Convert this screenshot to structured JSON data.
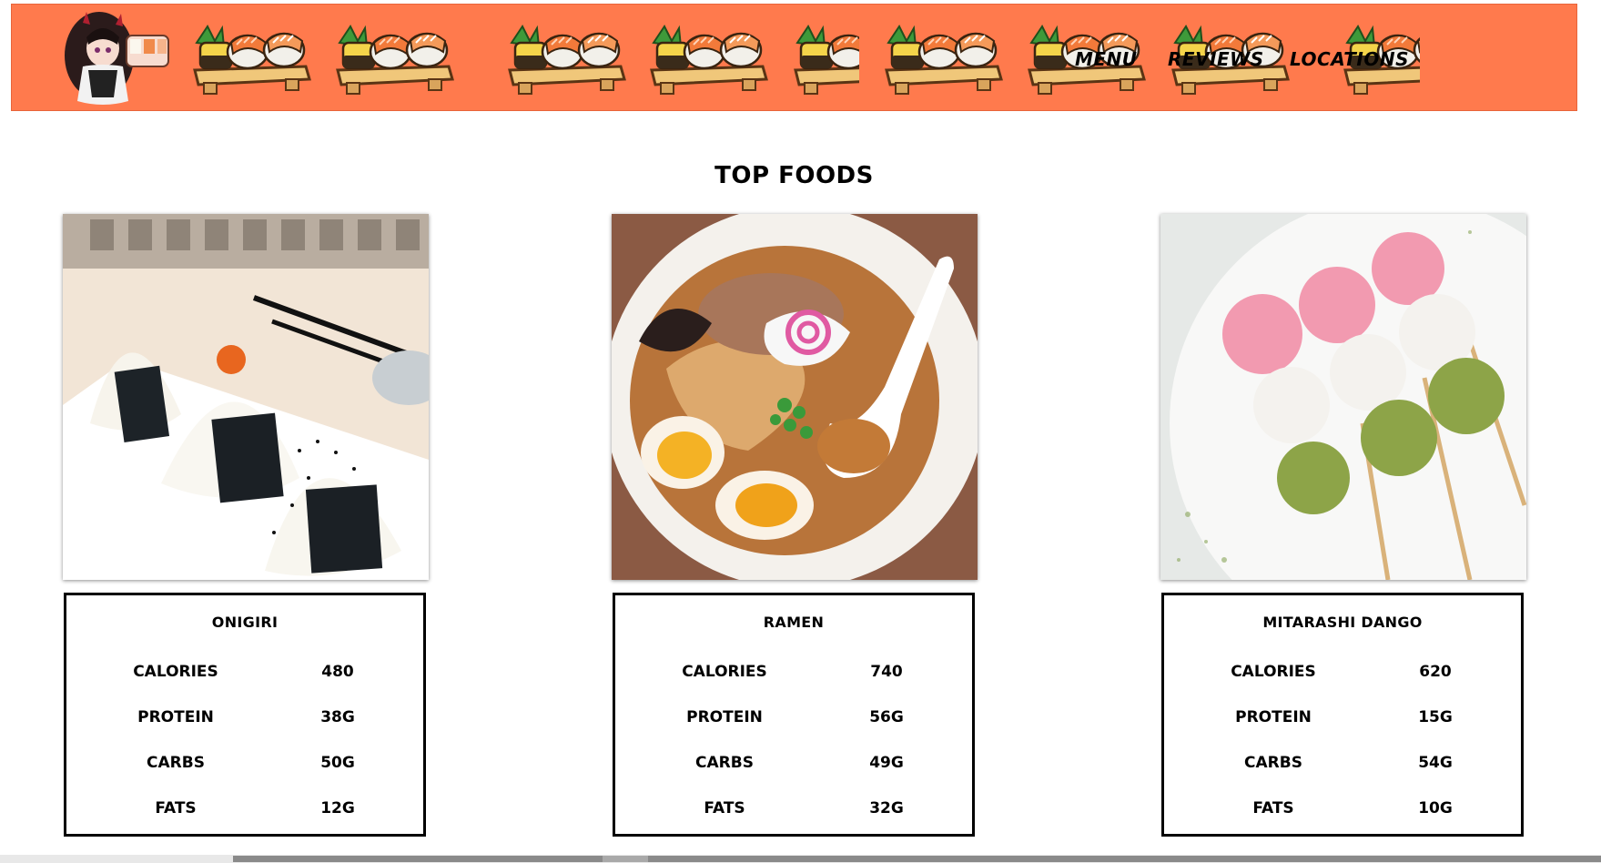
{
  "header": {
    "background_color": "#ff7a4d",
    "nav": [
      {
        "label": "Menu"
      },
      {
        "label": "Reviews"
      },
      {
        "label": "Locations"
      }
    ]
  },
  "main": {
    "section_title": "TOP FOODS",
    "foods": [
      {
        "name": "ONIGIRI",
        "image": "onigiri-photo",
        "stats": [
          {
            "label": "CALORIES",
            "value": "480"
          },
          {
            "label": "PROTEIN",
            "value": "38G"
          },
          {
            "label": "CARBS",
            "value": "50G"
          },
          {
            "label": "FATS",
            "value": "12G"
          }
        ]
      },
      {
        "name": "RAMEN",
        "image": "ramen-photo",
        "stats": [
          {
            "label": "CALORIES",
            "value": "740"
          },
          {
            "label": "PROTEIN",
            "value": "56G"
          },
          {
            "label": "CARBS",
            "value": "49G"
          },
          {
            "label": "FATS",
            "value": "32G"
          }
        ]
      },
      {
        "name": "MITARASHI DANGO",
        "image": "dango-photo",
        "stats": [
          {
            "label": "CALORIES",
            "value": "620"
          },
          {
            "label": "PROTEIN",
            "value": "15G"
          },
          {
            "label": "CARBS",
            "value": "54G"
          },
          {
            "label": "FATS",
            "value": "10G"
          }
        ]
      }
    ]
  }
}
